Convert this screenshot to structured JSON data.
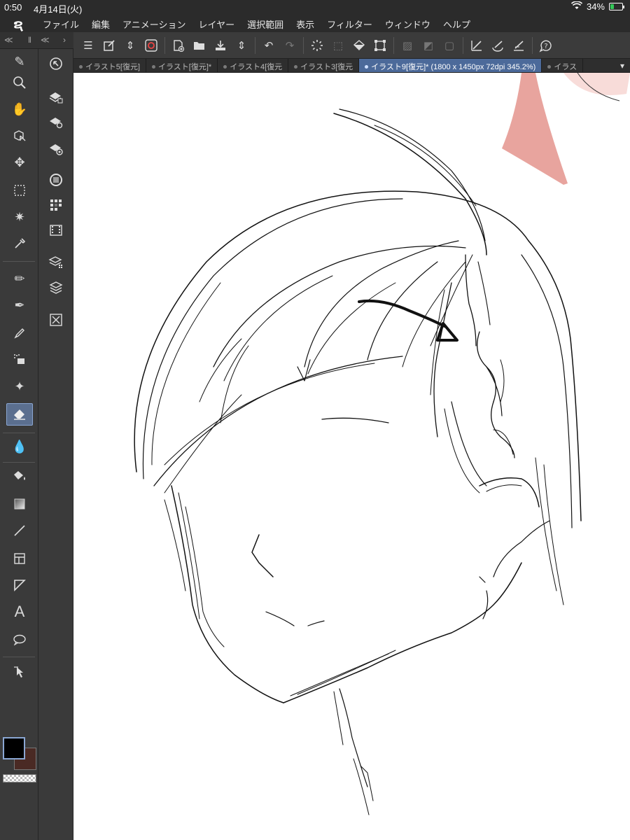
{
  "status": {
    "time": "0:50",
    "date": "4月14日(火)",
    "battery_text": "34%",
    "battery_level": 0.34,
    "battery_color": "#34c759"
  },
  "menu": {
    "logo": "ຊ",
    "items": [
      "ファイル",
      "編集",
      "アニメーション",
      "レイヤー",
      "選択範囲",
      "表示",
      "フィルター",
      "ウィンドウ",
      "ヘルプ"
    ]
  },
  "tabs": [
    {
      "label": "イラスト5[復元]",
      "active": false
    },
    {
      "label": "イラスト[復元]*",
      "active": false
    },
    {
      "label": "イラスト4[復元",
      "active": false
    },
    {
      "label": "イラスト3[復元",
      "active": false
    },
    {
      "label": "イラスト9[復元]* (1800 x 1450px 72dpi 345.2%)",
      "active": true
    },
    {
      "label": "イラス",
      "active": false
    }
  ],
  "colors": {
    "main": "#000000",
    "sub": "#4a2a24",
    "accent": "#4c6a9a"
  },
  "icons": {
    "tools": [
      "pen-icon",
      "zoom-icon",
      "hand-icon",
      "object-icon",
      "move-icon",
      "selection-icon",
      "auto-select-icon",
      "eyedropper-icon",
      "pencil-icon",
      "pen-tool-icon",
      "marker-icon",
      "airbrush-icon",
      "decoration-icon",
      "eraser-icon",
      "blend-icon",
      "fill-icon",
      "gradient-icon",
      "line-icon",
      "frame-icon",
      "ruler-icon",
      "text-icon",
      "balloon-icon",
      "correct-line-icon"
    ],
    "subtools": [
      "navigator-icon",
      "layer-property-icon",
      "layer-search-icon",
      "material-icon",
      "color-wheel-icon",
      "color-set-icon",
      "timeline-icon",
      "layer-stack-icon",
      "layer-icon",
      "close-panel-icon"
    ]
  }
}
